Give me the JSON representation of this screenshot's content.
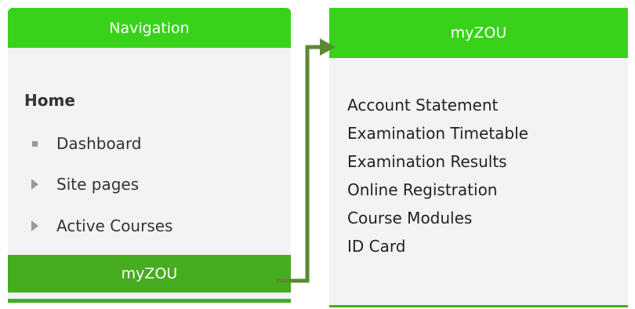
{
  "navigation": {
    "header": "Navigation",
    "home": "Home",
    "items": [
      {
        "label": "Dashboard",
        "icon": "square-bullet-icon"
      },
      {
        "label": "Site pages",
        "icon": "triangle-right-icon"
      },
      {
        "label": "Active Courses",
        "icon": "triangle-right-icon"
      }
    ],
    "myzou_label": "myZOU"
  },
  "myzou_panel": {
    "header": "myZOU",
    "links": [
      "Account Statement",
      "Examination Timetable",
      "Examination Results",
      "Online Registration",
      "Course Modules",
      "ID Card"
    ]
  },
  "colors": {
    "header_green": "#39d21b",
    "active_green": "#45ad1f",
    "arrow_green": "#5a8a32",
    "panel_bg": "#f3f3f3"
  }
}
